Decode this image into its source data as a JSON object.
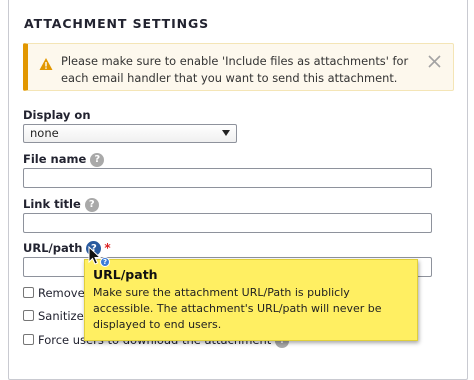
{
  "section": {
    "title": "ATTACHMENT SETTINGS"
  },
  "warning": {
    "message": "Please make sure to enable 'Include files as attachments' for each email handler that you want to send this attachment.",
    "icon": "warning-icon",
    "close_icon": "close-icon"
  },
  "display_on": {
    "label": "Display on",
    "value": "none"
  },
  "file_name": {
    "label": "File name",
    "value": ""
  },
  "link_title": {
    "label": "Link title",
    "value": ""
  },
  "url_path": {
    "label": "URL/path",
    "required_marker": "*",
    "value": ""
  },
  "help_glyph": "?",
  "checkboxes": [
    {
      "label": "Remove",
      "checked": false
    },
    {
      "label": "Sanitize f",
      "checked": false
    },
    {
      "label": "Force users to download the attachment",
      "checked": false
    }
  ],
  "tooltip": {
    "title": "URL/path",
    "body": "Make sure the attachment URL/Path is publicly accessible. The attachment's URL/path will never be displayed to end users."
  },
  "colors": {
    "warning_accent": "#e29700",
    "tooltip_bg": "#ffef62",
    "required": "#dc2323",
    "help_active": "#2a5a9e"
  }
}
